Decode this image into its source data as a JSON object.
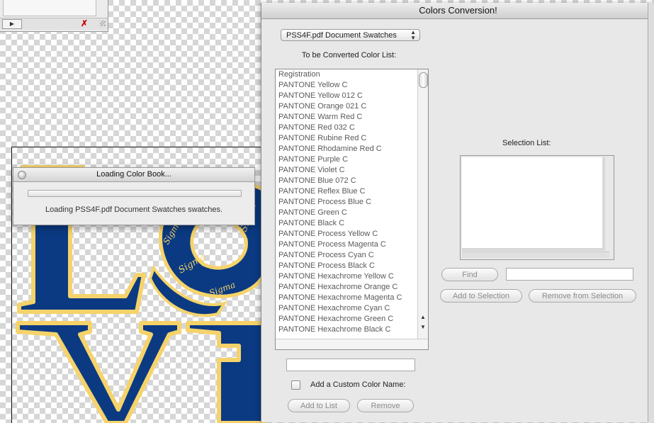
{
  "toolbar_panel": {
    "play_icon": "play-triangle",
    "tool_icon": "delete-x"
  },
  "loading_dialog": {
    "title": "Loading Color Book...",
    "message": "Loading PSS4F.pdf Document Swatches swatches."
  },
  "conversion_window": {
    "title": "Colors Conversion!",
    "source_dropdown": {
      "selected": "PSS4F.pdf Document Swatches"
    },
    "to_convert_label": "To be Converted Color List:",
    "color_list": [
      "Registration",
      "PANTONE Yellow C",
      "PANTONE Yellow 012 C",
      "PANTONE Orange 021 C",
      "PANTONE Warm Red C",
      "PANTONE Red 032 C",
      "PANTONE Rubine Red C",
      "PANTONE Rhodamine Red C",
      "PANTONE Purple C",
      "PANTONE Violet C",
      "PANTONE Blue 072 C",
      "PANTONE Reflex Blue C",
      "PANTONE Process Blue C",
      "PANTONE Green C",
      "PANTONE Black C",
      "PANTONE Process Yellow C",
      "PANTONE Process Magenta C",
      "PANTONE Process Cyan C",
      "PANTONE Process Black C",
      "PANTONE Hexachrome Yellow C",
      "PANTONE Hexachrome Orange C",
      "PANTONE Hexachrome Magenta C",
      "PANTONE Hexachrome Cyan C",
      "PANTONE Hexachrome Green C",
      "PANTONE Hexachrome Black C"
    ],
    "selection_label": "Selection List:",
    "find_button": "Find",
    "find_value": "",
    "add_to_selection_button": "Add to Selection",
    "remove_from_selection_button": "Remove from Selection",
    "custom_name_value": "",
    "custom_color_checkbox_label": "Add a Custom Color Name:",
    "add_to_list_button": "Add to List",
    "remove_button": "Remove"
  },
  "colors": {
    "navy": "#0b3a82",
    "gold": "#f5d36a",
    "window_bg": "#e8e8e8"
  }
}
